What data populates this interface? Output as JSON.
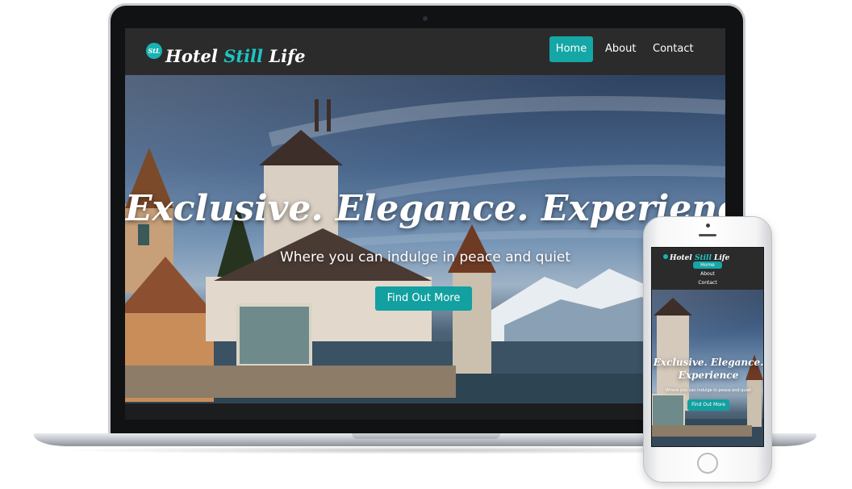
{
  "site": {
    "brand_badge": "StL",
    "brand_part1": "Hotel ",
    "brand_part2": "Still",
    "brand_part3": " Life",
    "nav": {
      "home": "Home",
      "about": "About",
      "contact": "Contact"
    },
    "hero": {
      "title": "Exclusive. Elegance. Experience",
      "title_mobile_line1": "Exclusive. Elegance.",
      "title_mobile_line2": "Experience",
      "subtitle": "Where you can indulge in peace and quiet",
      "cta": "Find Out More"
    }
  },
  "colors": {
    "accent": "#15a6a6",
    "navbar": "#2b2b2b",
    "device_frame": "#111214"
  },
  "icons": {
    "camera": "laptop-camera-icon",
    "home_button": "phone-home-button-icon"
  }
}
